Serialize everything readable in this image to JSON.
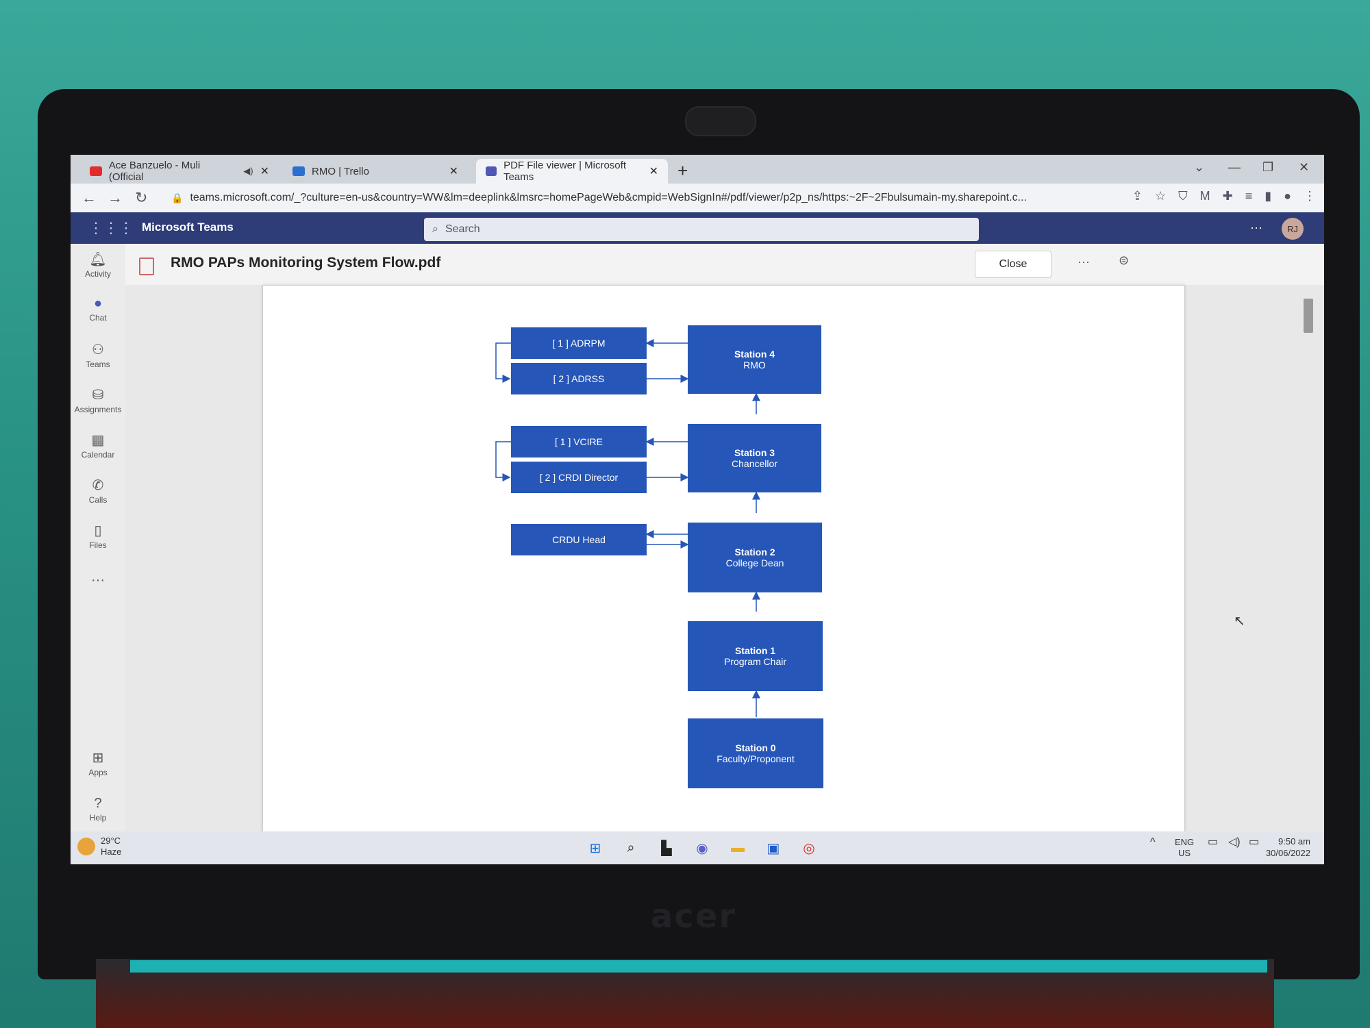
{
  "browser": {
    "tabs": [
      {
        "label": "Ace Banzuelo - Muli (Official",
        "favicon_color": "#e32b2b"
      },
      {
        "label": "RMO | Trello",
        "favicon_color": "#2b6fcf"
      },
      {
        "label": "PDF File viewer | Microsoft Teams",
        "favicon_color": "#5058b5"
      }
    ],
    "url": "teams.microsoft.com/_?culture=en-us&country=WW&lm=deeplink&lmsrc=homePageWeb&cmpid=WebSignIn#/pdf/viewer/p2p_ns/https:~2F~2Fbulsumain-my.sharepoint.c..."
  },
  "teams": {
    "app_title": "Microsoft Teams",
    "search_placeholder": "Search",
    "avatar_initials": "RJ",
    "rail": [
      {
        "label": "Activity",
        "icon": "bell-icon"
      },
      {
        "label": "Chat",
        "icon": "chat-icon"
      },
      {
        "label": "Teams",
        "icon": "teams-icon"
      },
      {
        "label": "Assignments",
        "icon": "assignments-icon"
      },
      {
        "label": "Calendar",
        "icon": "calendar-icon"
      },
      {
        "label": "Calls",
        "icon": "phone-icon"
      },
      {
        "label": "Files",
        "icon": "file-icon"
      },
      {
        "label": "Apps",
        "icon": "apps-icon"
      },
      {
        "label": "Help",
        "icon": "help-icon"
      }
    ]
  },
  "file": {
    "name": "RMO PAPs Monitoring System Flow.pdf",
    "close_label": "Close"
  },
  "diagram": {
    "accent": "#2656b8",
    "side_boxes": [
      "[ 1 ] ADRPM",
      "[ 2 ] ADRSS",
      "[ 1 ] VCIRE",
      "[ 2 ] CRDI Director",
      "CRDU Head"
    ],
    "stations": [
      {
        "title": "Station 4",
        "subtitle": "RMO"
      },
      {
        "title": "Station 3",
        "subtitle": "Chancellor"
      },
      {
        "title": "Station 2",
        "subtitle": "College Dean"
      },
      {
        "title": "Station 1",
        "subtitle": "Program Chair"
      },
      {
        "title": "Station 0",
        "subtitle": "Faculty/Proponent"
      }
    ]
  },
  "taskbar": {
    "temperature": "29°C",
    "condition": "Haze",
    "language": "ENG",
    "region": "US",
    "time": "9:50 am",
    "date": "30/06/2022"
  }
}
